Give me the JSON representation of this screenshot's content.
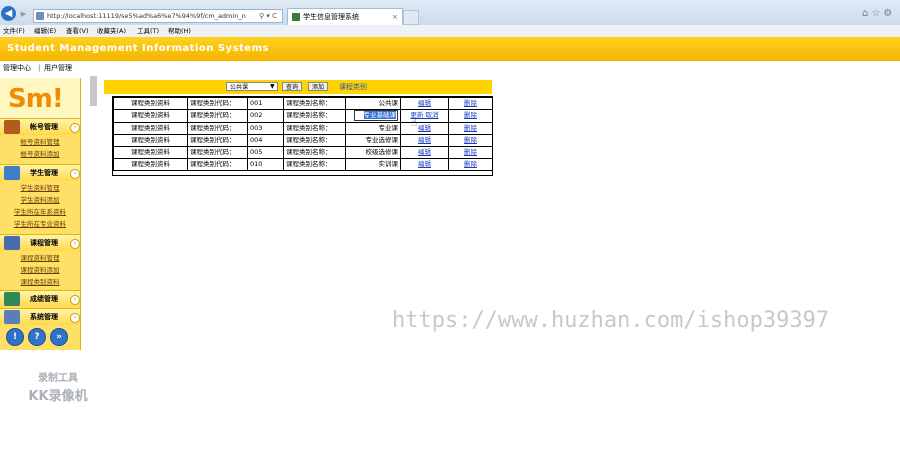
{
  "browser": {
    "address": "http://localhost:11119/se5%ad%a6%e7%94%9f/cm_admin_n",
    "address_controls": "⚲ ▾ C",
    "tab_title": "学生信息管理系统",
    "tab_close": "×",
    "right_icons": "⌂☆⚙",
    "menu": [
      "文件(F)",
      "编辑(E)",
      "查看(V)",
      "收藏夹(A)",
      "工具(T)",
      "帮助(H)"
    ]
  },
  "header": {
    "title": "Student Management Information Systems"
  },
  "breadcrumb": {
    "item1": "管理中心",
    "sep": "|",
    "item2": "用户管理"
  },
  "sidebar": {
    "logo": "Sm!",
    "sections": [
      {
        "title": "帐号管理",
        "links": [
          "帐号资料管理",
          "帐号资料添加"
        ]
      },
      {
        "title": "学生管理",
        "links": [
          "学生资料管理",
          "学生资料添加",
          "学生所在年系资料",
          "学生所在专业资料"
        ]
      },
      {
        "title": "课程管理",
        "links": [
          "课程资料管理",
          "课程资料添加",
          "课程类别资料"
        ]
      },
      {
        "title": "成绩管理",
        "links": []
      },
      {
        "title": "系统管理",
        "links": []
      }
    ],
    "bottom_buttons": [
      "!",
      "?",
      "»"
    ]
  },
  "toolbar": {
    "select_value": "公共课",
    "query_label": "查询",
    "add_label": "添加",
    "title_text": "课程类别"
  },
  "table": {
    "rows": [
      {
        "c1": "课程类别资料",
        "c2": "课程类别代码：",
        "c3": "001",
        "c4": "课程类别名称：",
        "c5": "公共课",
        "a1": "编辑",
        "a2": "删除",
        "editing": false
      },
      {
        "c1": "课程类别资料",
        "c2": "课程类别代码：",
        "c3": "002",
        "c4": "课程类别名称：",
        "c5": "专业基础课",
        "a1": "更新",
        "a1b": "取消",
        "a2": "删除",
        "editing": true
      },
      {
        "c1": "课程类别资料",
        "c2": "课程类别代码：",
        "c3": "003",
        "c4": "课程类别名称：",
        "c5": "专业课",
        "a1": "编辑",
        "a2": "删除",
        "editing": false
      },
      {
        "c1": "课程类别资料",
        "c2": "课程类别代码：",
        "c3": "004",
        "c4": "课程类别名称：",
        "c5": "专业选修课",
        "a1": "编辑",
        "a2": "删除",
        "editing": false
      },
      {
        "c1": "课程类别资料",
        "c2": "课程类别代码：",
        "c3": "005",
        "c4": "课程类别名称：",
        "c5": "校级选修课",
        "a1": "编辑",
        "a2": "删除",
        "editing": false
      },
      {
        "c1": "课程类别资料",
        "c2": "课程类别代码：",
        "c3": "010",
        "c4": "课程类别名称：",
        "c5": "实训课",
        "a1": "编辑",
        "a2": "删除",
        "editing": false
      }
    ]
  },
  "overlay": {
    "watermark": "https://www.huzhan.com/ishop39397",
    "kk_line1": "录制工具",
    "kk_line2": "KK录像机"
  },
  "colors": {
    "header_yellow": "#f4b400",
    "sidebar_yellow": "#ffe066",
    "link_blue": "#1a3fc0"
  }
}
